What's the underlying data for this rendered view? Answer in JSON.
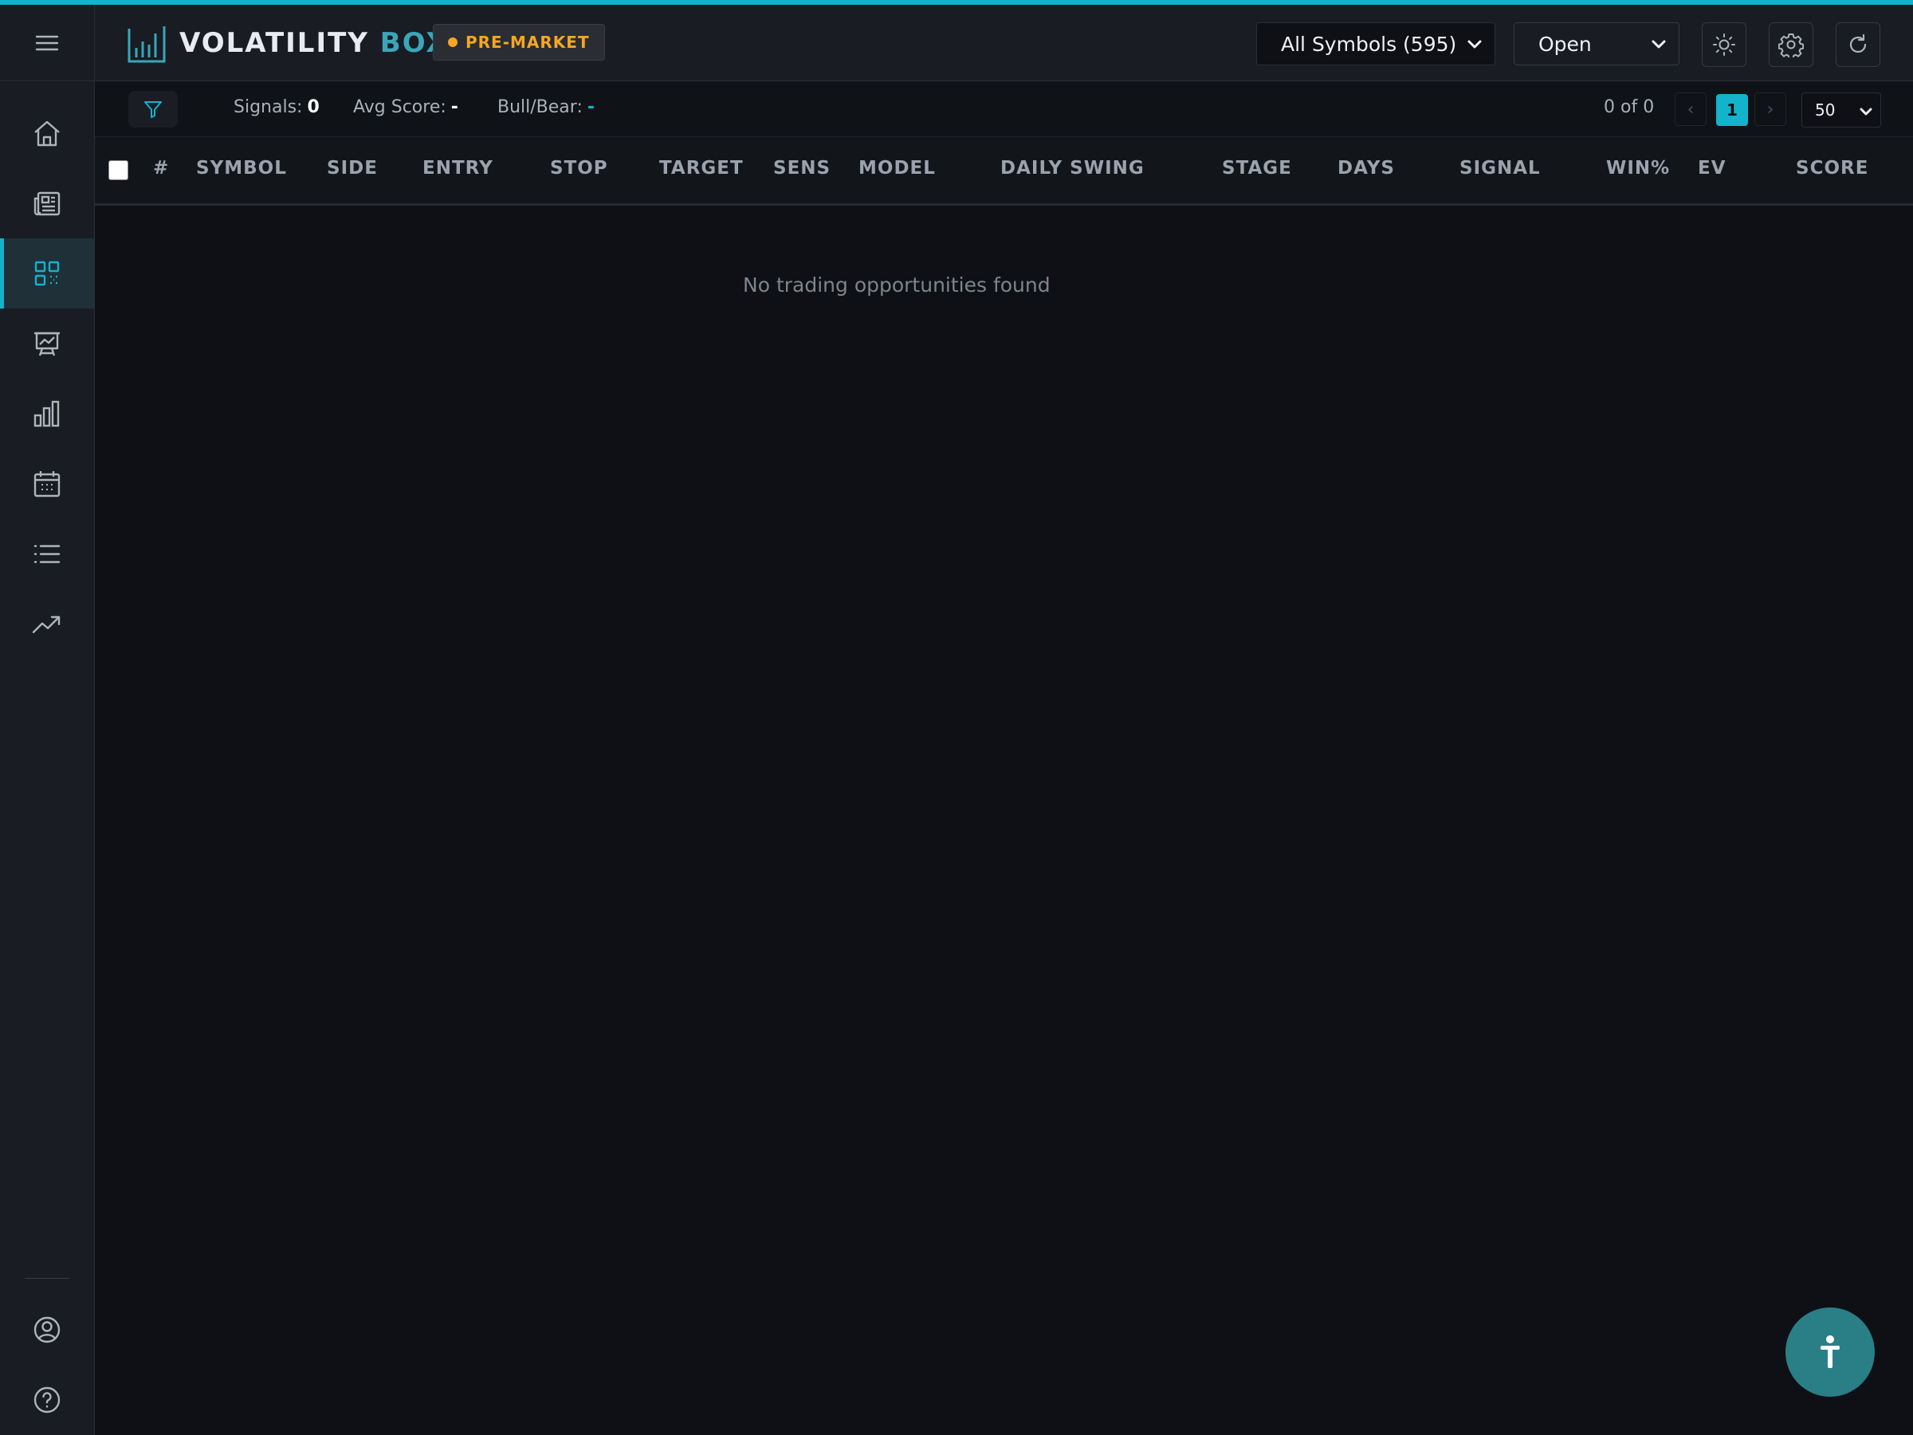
{
  "app": {
    "brand_part1": "VOLATILITY",
    "brand_part2": "BOX",
    "market_status": "PRE-MARKET",
    "accent_color": "#13b3cc",
    "market_color": "#f5a623"
  },
  "header": {
    "symbols_select": {
      "value": "All Symbols (595)"
    },
    "status_select": {
      "value": "Open"
    },
    "icons": [
      "theme-toggle-icon",
      "settings-icon",
      "refresh-icon"
    ]
  },
  "sidebar": {
    "items": [
      {
        "icon": "home-icon"
      },
      {
        "icon": "news-icon"
      },
      {
        "icon": "scanner-icon",
        "active": true
      },
      {
        "icon": "presentation-chart-icon"
      },
      {
        "icon": "bar-chart-icon"
      },
      {
        "icon": "calendar-icon"
      },
      {
        "icon": "list-icon"
      },
      {
        "icon": "trending-up-icon"
      }
    ],
    "bottom": [
      {
        "icon": "user-icon"
      },
      {
        "icon": "help-icon"
      }
    ]
  },
  "stats": {
    "signals_label": "Signals:",
    "signals_value": "0",
    "avg_score_label": "Avg Score:",
    "avg_score_value": "-",
    "bullbear_label": "Bull/Bear:",
    "bullbear_value": "-"
  },
  "pagination": {
    "count": "0 of 0",
    "prev": "‹",
    "current_page": "1",
    "next": "›",
    "per_page": "50"
  },
  "table": {
    "columns": [
      "#",
      "SYMBOL",
      "SIDE",
      "ENTRY",
      "STOP",
      "TARGET",
      "SENS",
      "MODEL",
      "DAILY SWING",
      "STAGE",
      "DAYS",
      "SIGNAL",
      "WIN%",
      "EV",
      "SCORE"
    ],
    "rows": [],
    "empty_message": "No trading opportunities found"
  }
}
